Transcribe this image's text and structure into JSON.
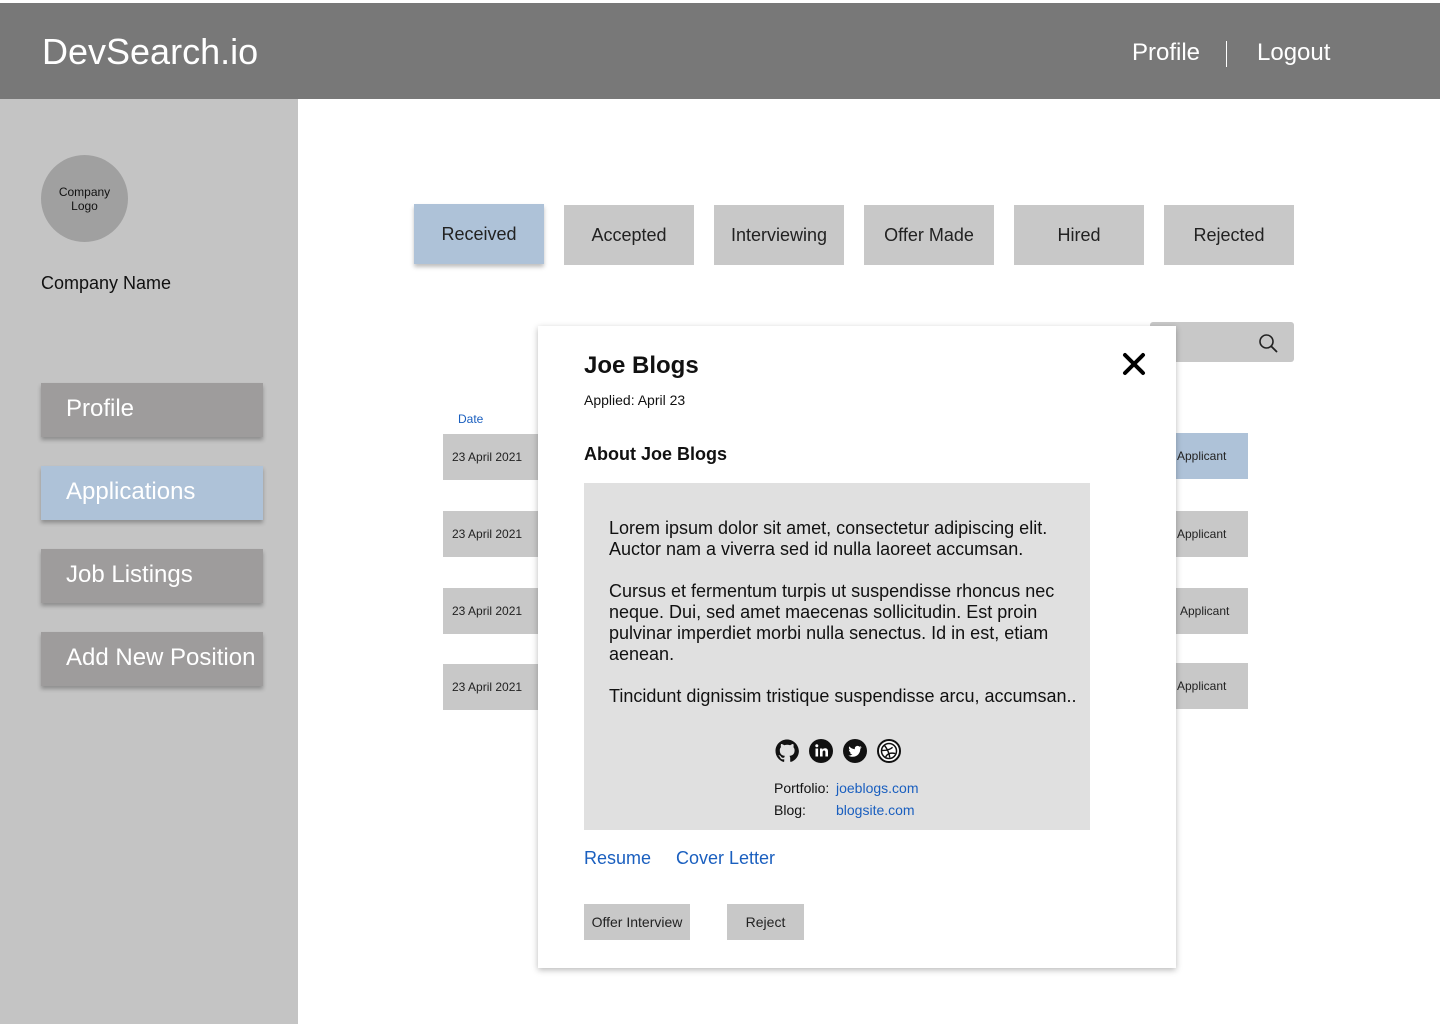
{
  "header": {
    "brand": "DevSearch.io",
    "nav": {
      "profile": "Profile",
      "logout": "Logout"
    }
  },
  "sidebar": {
    "logo_text": "Company Logo",
    "company_name": "Company Name",
    "items": [
      {
        "label": "Profile",
        "active": false
      },
      {
        "label": "Applications",
        "active": true
      },
      {
        "label": "Job Listings",
        "active": false
      },
      {
        "label": "Add New Position",
        "active": false
      }
    ]
  },
  "tabs": [
    {
      "label": "Received",
      "active": true
    },
    {
      "label": "Accepted",
      "active": false
    },
    {
      "label": "Interviewing",
      "active": false
    },
    {
      "label": "Offer Made",
      "active": false
    },
    {
      "label": "Hired",
      "active": false
    },
    {
      "label": "Rejected",
      "active": false
    }
  ],
  "search": {
    "icon": "search-icon"
  },
  "table": {
    "date_header": "Date",
    "rows": [
      {
        "date": "23 April 2021",
        "action": "Applicant"
      },
      {
        "date": "23 April 2021",
        "action": "Applicant"
      },
      {
        "date": "23 April 2021",
        "action": "Applicant"
      },
      {
        "date": "23 April 2021",
        "action": "Applicant"
      }
    ]
  },
  "modal": {
    "name": "Joe Blogs",
    "applied": "Applied: April 23",
    "about_heading": "About Joe Blogs",
    "paragraphs": [
      "Lorem ipsum dolor sit amet, consectetur adipiscing elit. Auctor nam a viverra sed id nulla laoreet accumsan.",
      "Cursus et fermentum turpis ut suspendisse rhoncus nec neque. Dui, sed amet maecenas sollicitudin. Est proin pulvinar imperdiet morbi nulla senectus. Id in est, etiam aenean.",
      "Tincidunt dignissim tristique suspendisse arcu, accumsan.."
    ],
    "socials": [
      "github-icon",
      "linkedin-icon",
      "twitter-icon",
      "dribbble-icon"
    ],
    "portfolio_label": "Portfolio:",
    "portfolio_url": "joeblogs.com",
    "blog_label": "Blog:",
    "blog_url": "blogsite.com",
    "resume_link": "Resume",
    "cover_letter_link": "Cover Letter",
    "offer_button": "Offer Interview",
    "reject_button": "Reject"
  },
  "colors": {
    "header_bg": "#787878",
    "sidebar_bg": "#c4c4c4",
    "nav_button": "#9e9c9c",
    "active_accent": "#aec2d8",
    "link": "#1a5fbf"
  }
}
